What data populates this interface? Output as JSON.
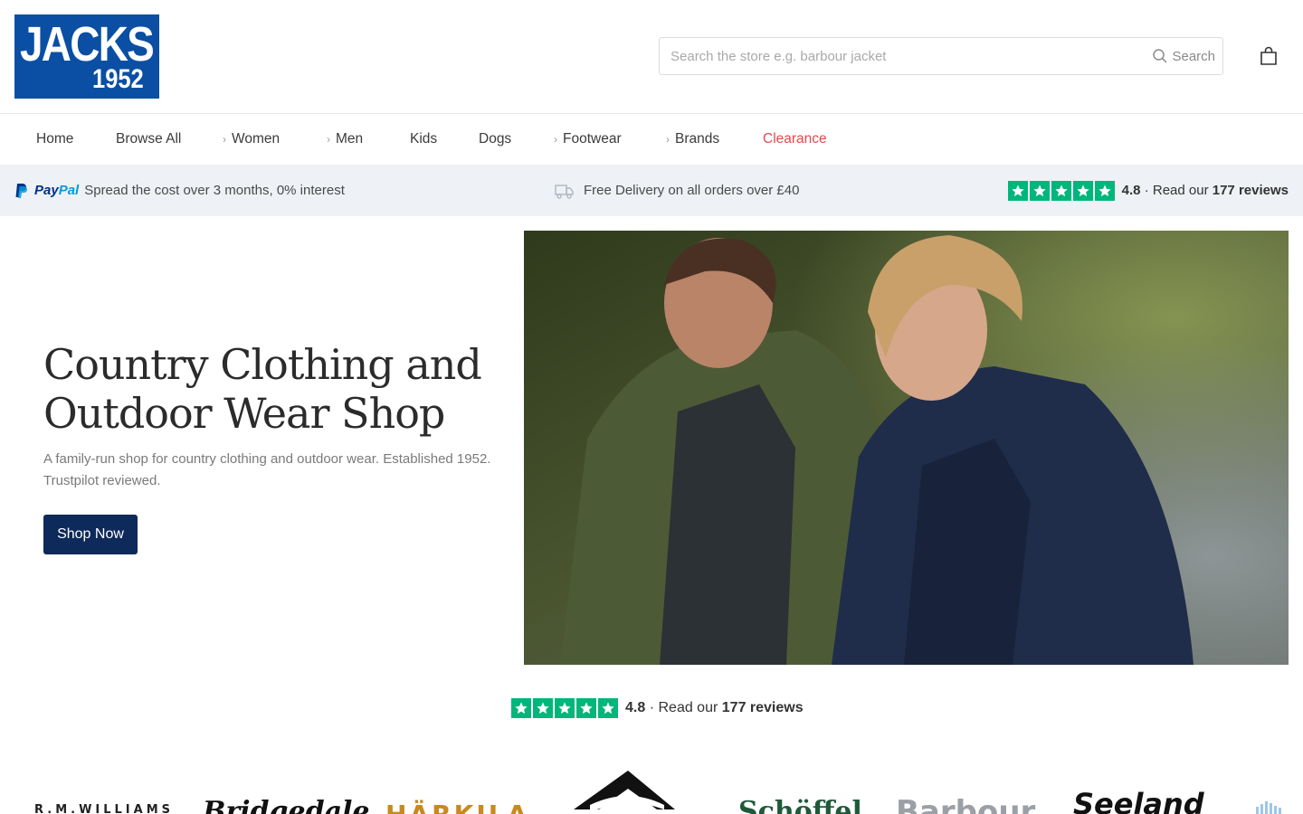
{
  "header": {
    "logo_line1": "JACKS",
    "logo_line2": "1952",
    "search_placeholder": "Search the store e.g. barbour jacket",
    "search_label": "Search"
  },
  "nav": {
    "items": [
      {
        "label": "Home",
        "has_chevron": false
      },
      {
        "label": "Browse All",
        "has_chevron": false
      },
      {
        "label": "Women",
        "has_chevron": true
      },
      {
        "label": "Men",
        "has_chevron": true
      },
      {
        "label": "Kids",
        "has_chevron": false
      },
      {
        "label": "Dogs",
        "has_chevron": false
      },
      {
        "label": "Footwear",
        "has_chevron": true
      },
      {
        "label": "Brands",
        "has_chevron": true
      },
      {
        "label": "Clearance",
        "has_chevron": false
      }
    ],
    "clearance_color": "#e5484d"
  },
  "infobar": {
    "paypal_pay": "Pay",
    "paypal_pal": "Pal",
    "paypal_text": "Spread the cost over 3 months, 0% interest",
    "delivery_text": "Free Delivery on all orders over £40",
    "rating": "4.8",
    "rating_sep": "·",
    "rating_prefix": "Read our",
    "reviews": "177 reviews"
  },
  "hero": {
    "title": "Country Clothing and Outdoor Wear Shop",
    "subtitle": "A family-run shop for country clothing and outdoor wear. Established 1952. Trustpilot reviewed.",
    "button": "Shop Now"
  },
  "trustpilot": {
    "rating": "4.8",
    "rating_sep": "·",
    "rating_prefix": "Read our",
    "reviews": "177 reviews",
    "star_color": "#00b67a"
  },
  "brands": [
    "R.M.WILLIAMS",
    "Bridgedale",
    "HÄRKILA",
    "",
    "Schöffel",
    "Barbour",
    "Seeland"
  ],
  "colors": {
    "logo_bg": "#0a4fa3",
    "button_bg": "#0d2a5a",
    "infobar_bg": "#eef1f5"
  }
}
